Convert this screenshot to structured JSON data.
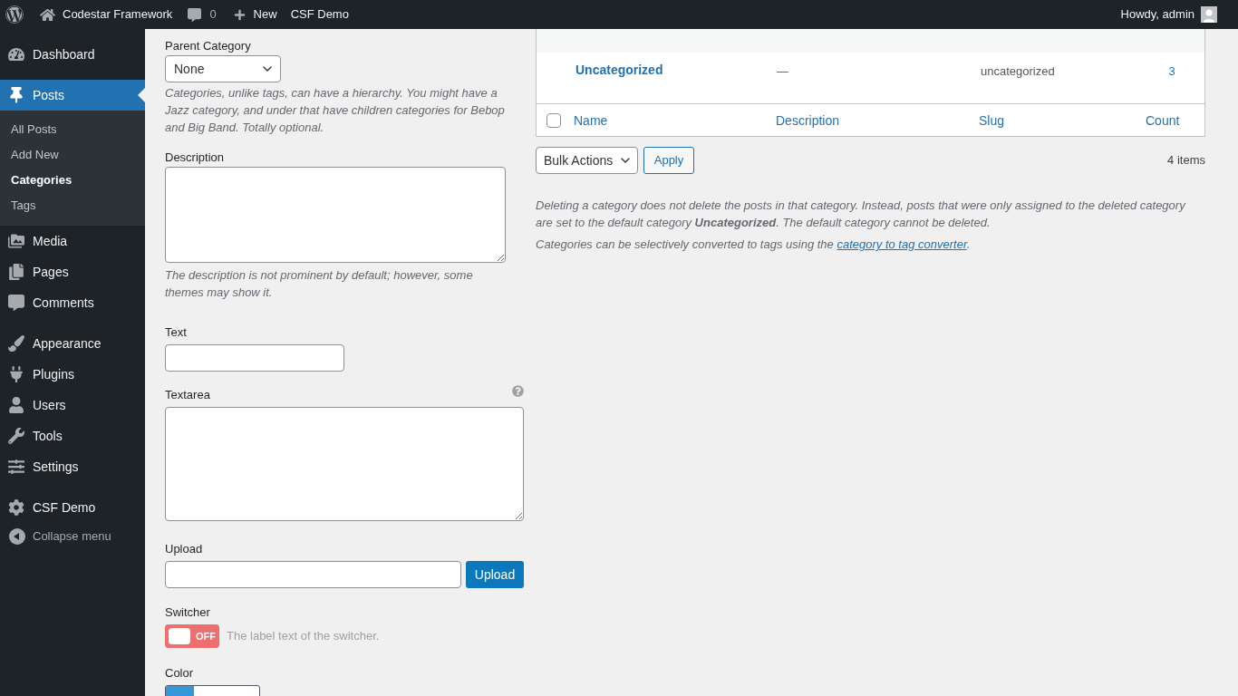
{
  "admin_bar": {
    "site_name": "Codestar Framework",
    "comment_count": "0",
    "new_label": "New",
    "menu_link": "CSF Demo",
    "greeting": "Howdy, admin"
  },
  "sidebar": {
    "groups": [
      {
        "items": [
          {
            "label": "Dashboard",
            "selected": false
          }
        ]
      },
      {
        "items": [
          {
            "label": "Posts",
            "selected": true,
            "children": [
              {
                "label": "All Posts",
                "selected": false
              },
              {
                "label": "Add New",
                "selected": false
              },
              {
                "label": "Categories",
                "selected": true
              },
              {
                "label": "Tags",
                "selected": false
              }
            ]
          },
          {
            "label": "Media",
            "selected": false
          },
          {
            "label": "Pages",
            "selected": false
          },
          {
            "label": "Comments",
            "selected": false
          }
        ]
      },
      {
        "items": [
          {
            "label": "Appearance",
            "selected": false
          },
          {
            "label": "Plugins",
            "selected": false
          },
          {
            "label": "Users",
            "selected": false
          },
          {
            "label": "Tools",
            "selected": false
          },
          {
            "label": "Settings",
            "selected": false
          }
        ]
      },
      {
        "items": [
          {
            "label": "CSF Demo",
            "selected": false
          }
        ]
      }
    ],
    "collapse_label": "Collapse menu"
  },
  "term_fields": [
    {
      "kind": "select",
      "label": "Parent Category",
      "value": "None",
      "help": "Categories, unlike tags, can have a hierarchy. You might have a Jazz category, and under that have children categories for Bebop and Big Band. Totally optional."
    },
    {
      "kind": "textarea",
      "label": "Description",
      "help": "The description is not prominent by default; however, some themes may show it."
    }
  ],
  "custom_fields": [
    {
      "kind": "text",
      "label": "Text",
      "help_icon": false
    },
    {
      "kind": "textarea",
      "label": "Textarea",
      "help_icon": true
    },
    {
      "kind": "upload",
      "label": "Upload",
      "help_icon": false,
      "button": "Upload"
    },
    {
      "kind": "switcher",
      "label": "Switcher",
      "help_icon": false,
      "on": false,
      "state_text": "OFF",
      "note": "The label text of the switcher."
    },
    {
      "kind": "color",
      "label": "Color",
      "help_icon": false,
      "color": "#3498db"
    }
  ],
  "table": {
    "rows": [
      {
        "name": "Uncategorized",
        "description": "—",
        "slug": "uncategorized",
        "count": "3"
      }
    ],
    "footer": {
      "select_all": {
        "checked": false
      },
      "columns": [
        "Name",
        "Description",
        "Slug",
        "Count"
      ]
    }
  },
  "bulk_actions": {
    "select": "Bulk Actions",
    "apply": "Apply",
    "item_count": "4 items"
  },
  "notes": [
    {
      "text": "Deleting a category does not delete the posts in that category. Instead, posts that were only assigned to the deleted category are set to the default category **Uncategorized**. The default category cannot be deleted."
    },
    {
      "text": "Categories can be selectively converted to tags using the ",
      "link": "category to tag converter",
      "after": "."
    }
  ]
}
